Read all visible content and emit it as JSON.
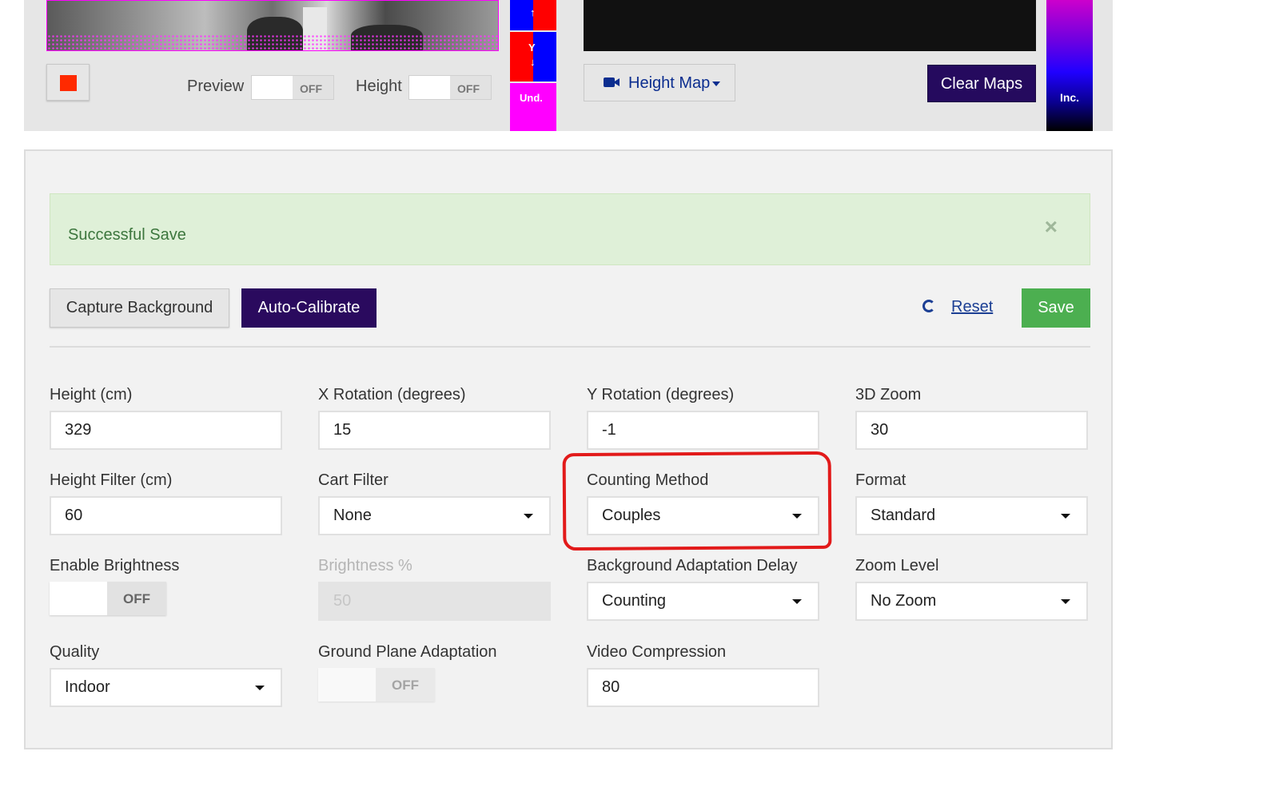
{
  "top": {
    "preview_label": "Preview",
    "preview_state": "OFF",
    "height_label": "Height",
    "height_state": "OFF",
    "axis_y_label": "Y",
    "axis_up": "↑",
    "axis_down": "↓",
    "axis_und_label": "Und.",
    "heightmap_label": "Height Map",
    "clear_maps_label": "Clear Maps",
    "scale_inc_label": "Inc.",
    "colors": {
      "stop": "#ff2a00",
      "axis_red": "#ff0000",
      "axis_blue": "#0000ff",
      "axis_magenta": "#ff00ff",
      "clear_maps_bg": "#250a5e"
    }
  },
  "alert": {
    "message": "Successful Save",
    "close_glyph": "×"
  },
  "actions": {
    "capture_label": "Capture Background",
    "autocal_label": "Auto-Calibrate",
    "reset_label": "Reset",
    "save_label": "Save"
  },
  "fields": {
    "height": {
      "label": "Height (cm)",
      "value": "329"
    },
    "x_rotation": {
      "label": "X Rotation (degrees)",
      "value": "15"
    },
    "y_rotation": {
      "label": "Y Rotation (degrees)",
      "value": "-1"
    },
    "zoom3d": {
      "label": "3D Zoom",
      "value": "30"
    },
    "height_filter": {
      "label": "Height Filter (cm)",
      "value": "60"
    },
    "cart_filter": {
      "label": "Cart Filter",
      "value": "None"
    },
    "counting_method": {
      "label": "Counting Method",
      "value": "Couples"
    },
    "format": {
      "label": "Format",
      "value": "Standard"
    },
    "enable_brightness": {
      "label": "Enable Brightness",
      "state": "OFF"
    },
    "brightness": {
      "label": "Brightness %",
      "value": "50"
    },
    "bg_adapt_delay": {
      "label": "Background Adaptation Delay",
      "value": "Counting"
    },
    "zoom_level": {
      "label": "Zoom Level",
      "value": "No Zoom"
    },
    "quality": {
      "label": "Quality",
      "value": "Indoor"
    },
    "ground_plane": {
      "label": "Ground Plane Adaptation",
      "state": "OFF"
    },
    "video_compression": {
      "label": "Video Compression",
      "value": "80"
    }
  },
  "annotation_color": "#e21a1a"
}
